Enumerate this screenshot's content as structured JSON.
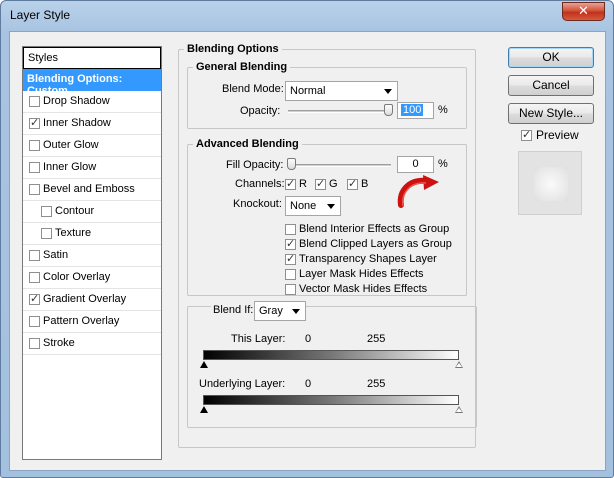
{
  "window": {
    "title": "Layer Style"
  },
  "sidebar": {
    "header": "Styles",
    "items": [
      {
        "label": "Blending Options: Custom",
        "selected": true,
        "checkbox": false,
        "checked": false
      },
      {
        "label": "Drop Shadow",
        "checkbox": true,
        "checked": false
      },
      {
        "label": "Inner Shadow",
        "checkbox": true,
        "checked": true
      },
      {
        "label": "Outer Glow",
        "checkbox": true,
        "checked": false
      },
      {
        "label": "Inner Glow",
        "checkbox": true,
        "checked": false
      },
      {
        "label": "Bevel and Emboss",
        "checkbox": true,
        "checked": false
      },
      {
        "label": "Contour",
        "checkbox": true,
        "checked": false,
        "indent": true
      },
      {
        "label": "Texture",
        "checkbox": true,
        "checked": false,
        "indent": true
      },
      {
        "label": "Satin",
        "checkbox": true,
        "checked": false
      },
      {
        "label": "Color Overlay",
        "checkbox": true,
        "checked": false
      },
      {
        "label": "Gradient Overlay",
        "checkbox": true,
        "checked": true
      },
      {
        "label": "Pattern Overlay",
        "checkbox": true,
        "checked": false
      },
      {
        "label": "Stroke",
        "checkbox": true,
        "checked": false
      }
    ]
  },
  "blending_options": {
    "title": "Blending Options",
    "general": {
      "title": "General Blending",
      "blend_mode_label": "Blend Mode:",
      "blend_mode_value": "Normal",
      "opacity_label": "Opacity:",
      "opacity_value": "100",
      "opacity_unit": "%",
      "opacity_level": 1.0
    },
    "advanced": {
      "title": "Advanced Blending",
      "fill_opacity_label": "Fill Opacity:",
      "fill_opacity_value": "0",
      "fill_opacity_unit": "%",
      "fill_opacity_level": 0.0,
      "channels_label": "Channels:",
      "channels": [
        {
          "label": "R",
          "checked": true
        },
        {
          "label": "G",
          "checked": true
        },
        {
          "label": "B",
          "checked": true
        }
      ],
      "knockout_label": "Knockout:",
      "knockout_value": "None",
      "options": [
        {
          "label": "Blend Interior Effects as Group",
          "checked": false
        },
        {
          "label": "Blend Clipped Layers as Group",
          "checked": true
        },
        {
          "label": "Transparency Shapes Layer",
          "checked": true
        },
        {
          "label": "Layer Mask Hides Effects",
          "checked": false
        },
        {
          "label": "Vector Mask Hides Effects",
          "checked": false
        }
      ]
    },
    "blend_if": {
      "label": "Blend If:",
      "value": "Gray",
      "this_layer_label": "This Layer:",
      "this_layer_low": "0",
      "this_layer_high": "255",
      "underlying_label": "Underlying Layer:",
      "underlying_low": "0",
      "underlying_high": "255"
    }
  },
  "buttons": {
    "ok": "OK",
    "cancel": "Cancel",
    "new_style": "New Style...",
    "preview_label": "Preview",
    "preview_checked": true
  },
  "colors": {
    "selection": "#3399ff",
    "annotation_arrow": "#cc1111",
    "close_button": "#c2301b"
  }
}
